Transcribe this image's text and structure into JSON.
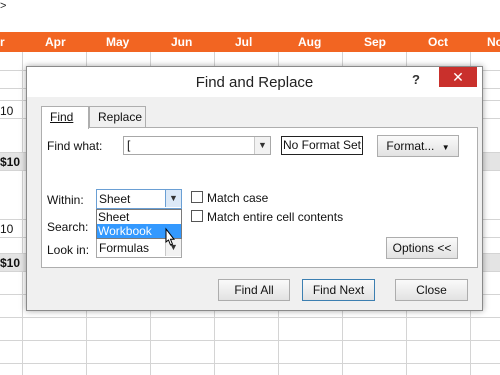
{
  "top_glyph": ">",
  "spreadsheet": {
    "months": [
      "Apr",
      "May",
      "Jun",
      "Jul",
      "Aug",
      "Sep",
      "Oct",
      "No"
    ],
    "cell_values": [
      "10",
      "$10",
      "10",
      "$10"
    ],
    "header_color": "#f26522"
  },
  "dialog": {
    "title": "Find and Replace",
    "help": "?",
    "close": "✕",
    "tabs": [
      "Find",
      "Replace"
    ],
    "find_what_label": "Find what:",
    "find_what_value": "[",
    "format_status": "No Format Set",
    "format_button": "Format...",
    "within_label": "Within:",
    "within_value": "Sheet",
    "within_options": [
      "Sheet",
      "Workbook"
    ],
    "search_label": "Search:",
    "look_in_label": "Look in:",
    "look_in_value": "Formulas",
    "match_case": "Match case",
    "match_entire": "Match entire cell contents",
    "options_button": "Options <<",
    "find_all": "Find All",
    "find_next": "Find Next",
    "close_button": "Close"
  },
  "icons": {
    "dropdown_arrow": "chevron-down-icon",
    "cursor": "mouse-pointer-icon",
    "close": "close-icon"
  }
}
